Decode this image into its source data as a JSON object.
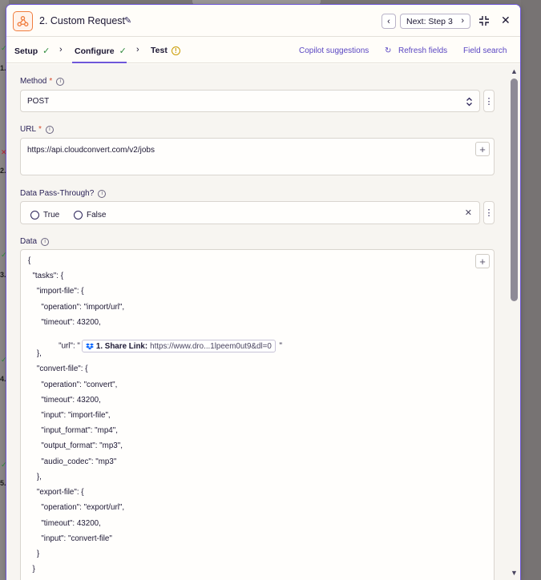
{
  "header": {
    "title": "2. Custom Request",
    "next_label": "Next: Step 3"
  },
  "tabs": [
    {
      "label": "Setup",
      "status": "complete"
    },
    {
      "label": "Configure",
      "status": "complete",
      "active": true
    },
    {
      "label": "Test",
      "status": "warning"
    }
  ],
  "tab_links": {
    "copilot": "Copilot suggestions",
    "refresh": "Refresh fields",
    "field_search": "Field search"
  },
  "background_steps": [
    "1.",
    "2.",
    "3.",
    "4.",
    "5."
  ],
  "fields": {
    "method": {
      "label": "Method",
      "required": true,
      "value": "POST"
    },
    "url": {
      "label": "URL",
      "required": true,
      "value": "https://api.cloudconvert.com/v2/jobs"
    },
    "pass_through": {
      "label": "Data Pass-Through?",
      "options": [
        "True",
        "False"
      ]
    },
    "data": {
      "label": "Data"
    }
  },
  "data_code": {
    "l01": "{",
    "l02": "  \"tasks\": {",
    "l03": "    \"import-file\": {",
    "l04": "      \"operation\": \"import/url\",",
    "l05": "      \"timeout\": 43200,",
    "l06_pre": "      \"url\": \"",
    "l06_post": " \"",
    "l07": "    },",
    "l08": "    \"convert-file\": {",
    "l09": "      \"operation\": \"convert\",",
    "l10": "      \"timeout\": 43200,",
    "l11": "      \"input\": \"import-file\",",
    "l12": "      \"input_format\": \"mp4\",",
    "l13": "      \"output_format\": \"mp3\",",
    "l14": "      \"audio_codec\": \"mp3\"",
    "l15": "    },",
    "l16": "    \"export-file\": {",
    "l17": "      \"operation\": \"export/url\",",
    "l18": "      \"timeout\": 43200,",
    "l19": "      \"input\": \"convert-file\"",
    "l20": "    }",
    "l21": "  }"
  },
  "mapped_pill": {
    "step": "1. Share Link:",
    "value": "https://www.dro...1lpeem0ut9&dl=0",
    "icon": "dropbox-icon"
  },
  "colors": {
    "accent": "#6e57d9",
    "app_brand": "#f07d3e",
    "success": "#2f8a3d",
    "warning": "#c99a00",
    "required": "#d64a2a"
  }
}
